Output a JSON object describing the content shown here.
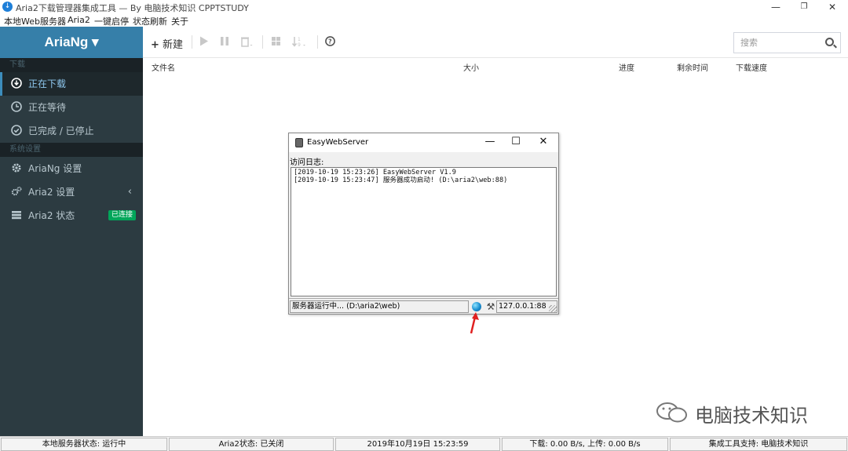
{
  "window": {
    "title": "Aria2下载管理器集成工具 — By 电脑技术知识 CPPTSTUDY",
    "minimize": "—",
    "restore": "❐",
    "close": "✕"
  },
  "menu": {
    "items": [
      "本地Web服务器",
      "Aria2",
      "一键启停",
      "状态刷新",
      "关于"
    ]
  },
  "sidebar": {
    "brand": "AriaNg ▾",
    "sections": [
      {
        "header": "下载",
        "items": [
          {
            "label": "正在下载",
            "icon": "download-circle-icon",
            "active": true
          },
          {
            "label": "正在等待",
            "icon": "clock-icon",
            "active": false
          },
          {
            "label": "已完成 / 已停止",
            "icon": "check-circle-icon",
            "active": false
          }
        ]
      },
      {
        "header": "系统设置",
        "items": [
          {
            "label": "AriaNg 设置",
            "icon": "gear-icon"
          },
          {
            "label": "Aria2 设置",
            "icon": "gears-icon",
            "chevron": "‹"
          },
          {
            "label": "Aria2 状态",
            "icon": "server-icon",
            "badge": "已连接"
          }
        ]
      }
    ]
  },
  "toolbar": {
    "new_label": "新建",
    "search_placeholder": "搜索"
  },
  "table": {
    "columns": [
      "文件名",
      "大小",
      "进度",
      "剩余时间",
      "下载速度"
    ]
  },
  "dialog": {
    "title": "EasyWebServer",
    "log_label": "访问日志:",
    "log_lines": [
      "[2019-10-19 15:23:26] EasyWebServer V1.9",
      "[2019-10-19 15:23:47] 服务器成功启动! (D:\\aria2\\web:88)"
    ],
    "status_text": "服务器运行中... (D:\\aria2\\web)",
    "address": "127.0.0.1:88"
  },
  "statusbar": {
    "local_server": "本地服务器状态: 运行中",
    "aria2_status": "Aria2状态: 已关闭",
    "datetime": "2019年10月19日 15:23:59",
    "speed": "下载: 0.00 B/s, 上传: 0.00 B/s",
    "support": "集成工具支持: 电脑技术知识"
  },
  "watermark": {
    "text": "电脑技术知识"
  },
  "colors": {
    "sidebar_bg": "#2c3b41",
    "brand_bg": "#367fa9",
    "badge_green": "#00a65a",
    "arrow_red": "#e02020"
  }
}
